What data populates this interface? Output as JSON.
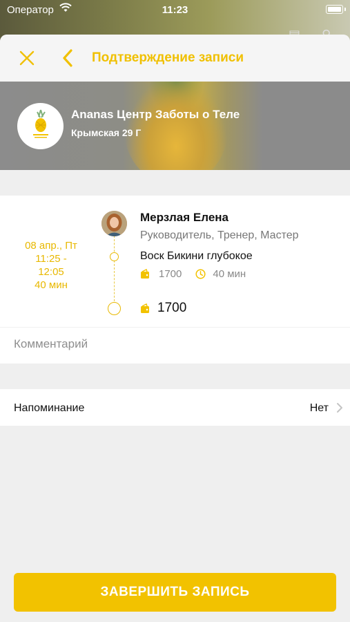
{
  "status_bar": {
    "carrier": "Оператор",
    "time": "11:23",
    "icons": [
      "wifi-icon",
      "battery-icon"
    ]
  },
  "header": {
    "title": "Подтверждение записи",
    "close_icon": "close-icon",
    "back_icon": "chevron-left-icon",
    "accent_color": "#f0c000"
  },
  "venue": {
    "name": "Ananas Центр Заботы о Теле",
    "address": "Крымская 29 Г",
    "logo_icon": "pineapple-logo"
  },
  "appointment": {
    "date": "08 апр., Пт",
    "time_start": "11:25 -",
    "time_end": "12:05",
    "duration": "40 мин",
    "specialist": {
      "name": "Мерзлая Елена",
      "roles": "Руководитель,  Тренер, Мастер"
    },
    "service": {
      "name": "Воск Бикини глубокое",
      "price": "1700",
      "duration": "40 мин"
    },
    "total": "1700"
  },
  "comment": {
    "placeholder": "Комментарий",
    "value": ""
  },
  "reminder": {
    "label": "Напоминание",
    "value": "Нет"
  },
  "finish_button": {
    "label": "ЗАВЕРШИТЬ ЗАПИСЬ",
    "color": "#f2c200"
  }
}
